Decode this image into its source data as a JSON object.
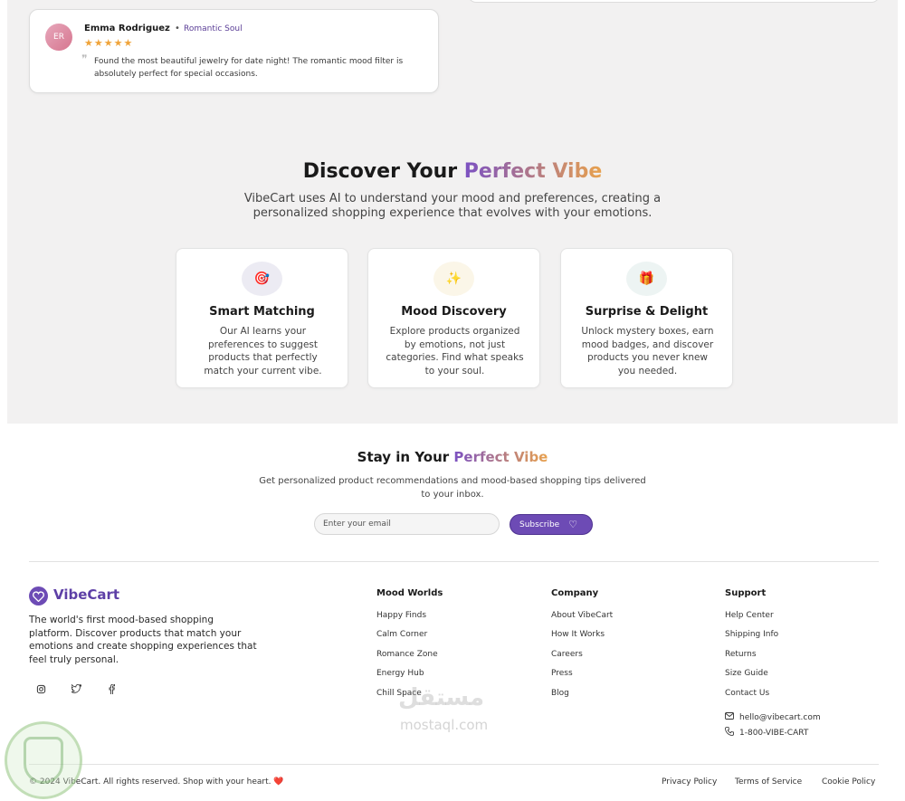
{
  "review": {
    "initials": "ER",
    "name": "Emma Rodriguez",
    "separator": "•",
    "tag": "Romantic Soul",
    "stars": "★★★★★",
    "rating": 5,
    "quote_icon": "❞",
    "text": "Found the most beautiful jewelry for date night! The romantic mood filter is absolutely perfect for special occasions."
  },
  "discover": {
    "title_prefix": "Discover Your ",
    "title_highlight": "Perfect Vibe",
    "subtitle": "VibeCart uses AI to understand your mood and preferences, creating a personalized shopping experience that evolves with your emotions.",
    "features": [
      {
        "icon": "🎯",
        "icon_name": "target-icon",
        "icon_bg": "#ecebf3",
        "title": "Smart Matching",
        "desc": "Our AI learns your preferences to suggest products that perfectly match your current vibe."
      },
      {
        "icon": "✨",
        "icon_name": "sparkles-icon",
        "icon_bg": "#fbf6e8",
        "title": "Mood Discovery",
        "desc": "Explore products organized by emotions, not just categories. Find what speaks to your soul."
      },
      {
        "icon": "🎁",
        "icon_name": "gift-icon",
        "icon_bg": "#edf4f3",
        "title": "Surprise & Delight",
        "desc": "Unlock mystery boxes, earn mood badges, and discover products you never knew you needed."
      }
    ]
  },
  "newsletter": {
    "title_prefix": "Stay in Your ",
    "title_highlight": "Perfect Vibe",
    "subtitle": "Get personalized product recommendations and mood-based shopping tips delivered to your inbox.",
    "email_placeholder": "Enter your email",
    "subscribe_label": "Subscribe",
    "subscribe_icon": "♡"
  },
  "footer": {
    "brand_name": "VibeCart",
    "brand_desc": "The world's first mood-based shopping platform. Discover products that match your emotions and create shopping experiences that feel truly personal.",
    "social": [
      {
        "icon": "◎",
        "name": "instagram-icon"
      },
      {
        "icon": "🐦",
        "name": "twitter-icon"
      },
      {
        "icon": "f",
        "name": "facebook-icon"
      }
    ],
    "columns": [
      {
        "title": "Mood Worlds",
        "links": [
          "Happy Finds",
          "Calm Corner",
          "Romance Zone",
          "Energy Hub",
          "Chill Space"
        ]
      },
      {
        "title": "Company",
        "links": [
          "About VibeCart",
          "How It Works",
          "Careers",
          "Press",
          "Blog"
        ]
      },
      {
        "title": "Support",
        "links": [
          "Help Center",
          "Shipping Info",
          "Returns",
          "Size Guide",
          "Contact Us"
        ]
      }
    ],
    "email": "hello@vibecart.com",
    "phone": "1-800-VIBE-CART",
    "copyright": "© 2024 VibeCart. All rights reserved. Shop with your heart.",
    "copyright_heart": "❤️",
    "legal": [
      "Privacy Policy",
      "Terms of Service",
      "Cookie Policy"
    ]
  },
  "watermark": {
    "text": "مستقل",
    "sub": "mostaql.com"
  },
  "colors": {
    "brand": "#6d4bb5",
    "gradient_start": "#7b51c2",
    "gradient_end": "#e8a14d",
    "star": "#f0a43a",
    "section_bg": "#f2f1f1"
  }
}
